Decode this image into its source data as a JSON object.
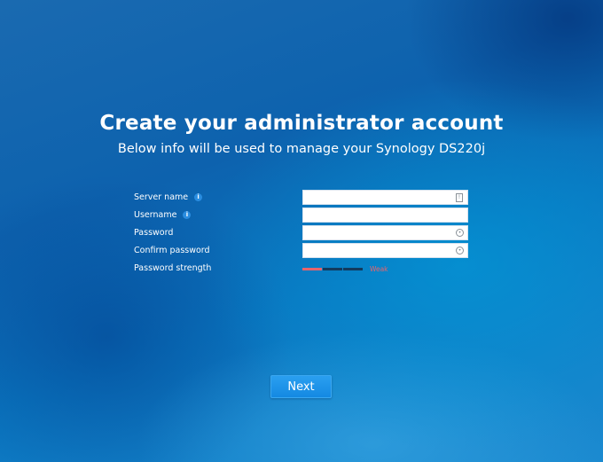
{
  "header": {
    "title": "Create your administrator account",
    "subtitle": "Below info will be used to manage your Synology DS220j"
  },
  "form": {
    "fields": [
      {
        "label": "Server name",
        "value": "",
        "has_info": true,
        "icon": "id-card-icon"
      },
      {
        "label": "Username",
        "value": "",
        "has_info": true,
        "icon": ""
      },
      {
        "label": "Password",
        "value": "",
        "has_info": false,
        "icon": "show-password-icon"
      },
      {
        "label": "Confirm password",
        "value": "",
        "has_info": false,
        "icon": "show-password-icon"
      }
    ],
    "strength": {
      "label": "Password strength",
      "level": 1,
      "max_level": 3,
      "text": "Weak",
      "color": "#e8646c"
    },
    "info_glyph": "i"
  },
  "actions": {
    "next_label": "Next"
  }
}
